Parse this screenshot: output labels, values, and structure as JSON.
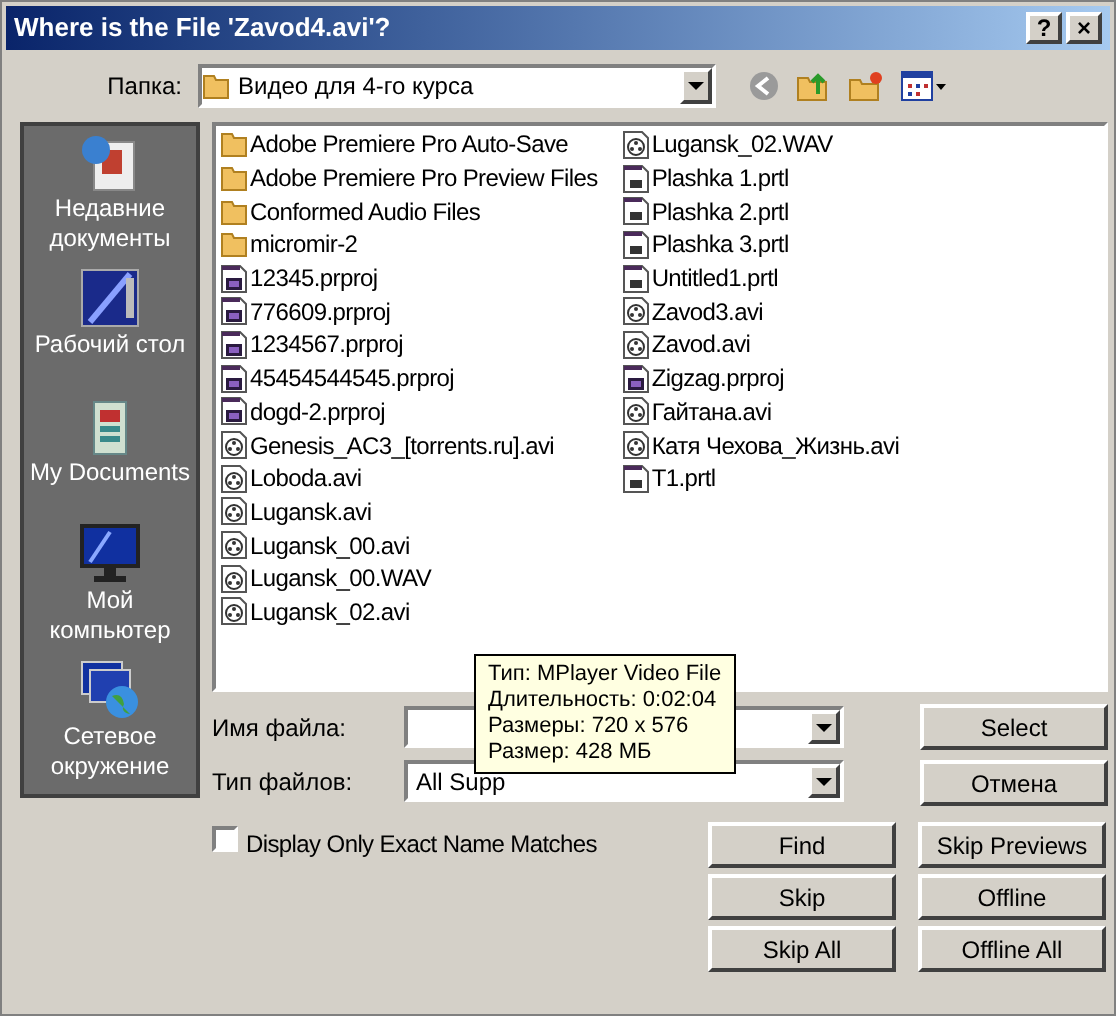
{
  "window": {
    "title": "Where is the File 'Zavod4.avi'?",
    "title_buttons": [
      "?",
      "×"
    ]
  },
  "folder_label": "Папка:",
  "folder": "Видео для 4-го курса",
  "places": [
    {
      "label": "Недавние документы",
      "kind": "recent"
    },
    {
      "label": "Рабочий стол",
      "kind": "desktop"
    },
    {
      "label": "My Documents",
      "kind": "documents"
    },
    {
      "label": "Мой компьютер",
      "kind": "computer"
    },
    {
      "label": "Сетевое окружение",
      "kind": "network"
    }
  ],
  "files": [
    {
      "name": "Adobe Premiere Pro Auto-Save",
      "kind": "folder"
    },
    {
      "name": "Adobe Premiere Pro Preview Files",
      "kind": "folder"
    },
    {
      "name": "Conformed Audio Files",
      "kind": "folder"
    },
    {
      "name": "micromir-2",
      "kind": "folder"
    },
    {
      "name": "12345.prproj",
      "kind": "premiere"
    },
    {
      "name": "776609.prproj",
      "kind": "premiere"
    },
    {
      "name": "1234567.prproj",
      "kind": "premiere"
    },
    {
      "name": "45454544545.prproj",
      "kind": "premiere"
    },
    {
      "name": "dogd-2.prproj",
      "kind": "premiere"
    },
    {
      "name": "Genesis_AC3_[torrents.ru].avi",
      "kind": "media"
    },
    {
      "name": "Loboda.avi",
      "kind": "media"
    },
    {
      "name": "Lugansk.avi",
      "kind": "media"
    },
    {
      "name": "Lugansk_00.avi",
      "kind": "media"
    },
    {
      "name": "Lugansk_00.WAV",
      "kind": "media"
    },
    {
      "name": "Lugansk_02.avi",
      "kind": "media"
    },
    {
      "name": "Lugansk_02.WAV",
      "kind": "media"
    },
    {
      "name": "Plashka 1.prtl",
      "kind": "title"
    },
    {
      "name": "Plashka 2.prtl",
      "kind": "title"
    },
    {
      "name": "Plashka 3.prtl",
      "kind": "title"
    },
    {
      "name": "Untitled1.prtl",
      "kind": "title"
    },
    {
      "name": "Zavod3.avi",
      "kind": "media"
    },
    {
      "name": "Zavod.avi",
      "kind": "media"
    },
    {
      "name": "Zigzag.prproj",
      "kind": "premiere"
    },
    {
      "name": "Гайтана.avi",
      "kind": "media"
    },
    {
      "name": "Катя Чехова_Жизнь.avi",
      "kind": "media"
    },
    {
      "name": "T1.prtl",
      "kind": "title"
    }
  ],
  "file_name": {
    "label": "Имя файла:"
  },
  "file_type": {
    "label": "Тип файлов:",
    "value": "All Supp"
  },
  "tooltip": [
    "Тип: MPlayer Video File",
    "Длительность: 0:02:04",
    "Размеры: 720 x 576",
    "Размер: 428 МБ"
  ],
  "exact_match": {
    "label": "Display Only Exact Name Matches",
    "checked": false
  },
  "buttons_right": [
    "Select",
    "Отмена"
  ],
  "buttons_grid": [
    "Find",
    "Skip Previews",
    "Skip",
    "Offline",
    "Skip All",
    "Offline All"
  ]
}
